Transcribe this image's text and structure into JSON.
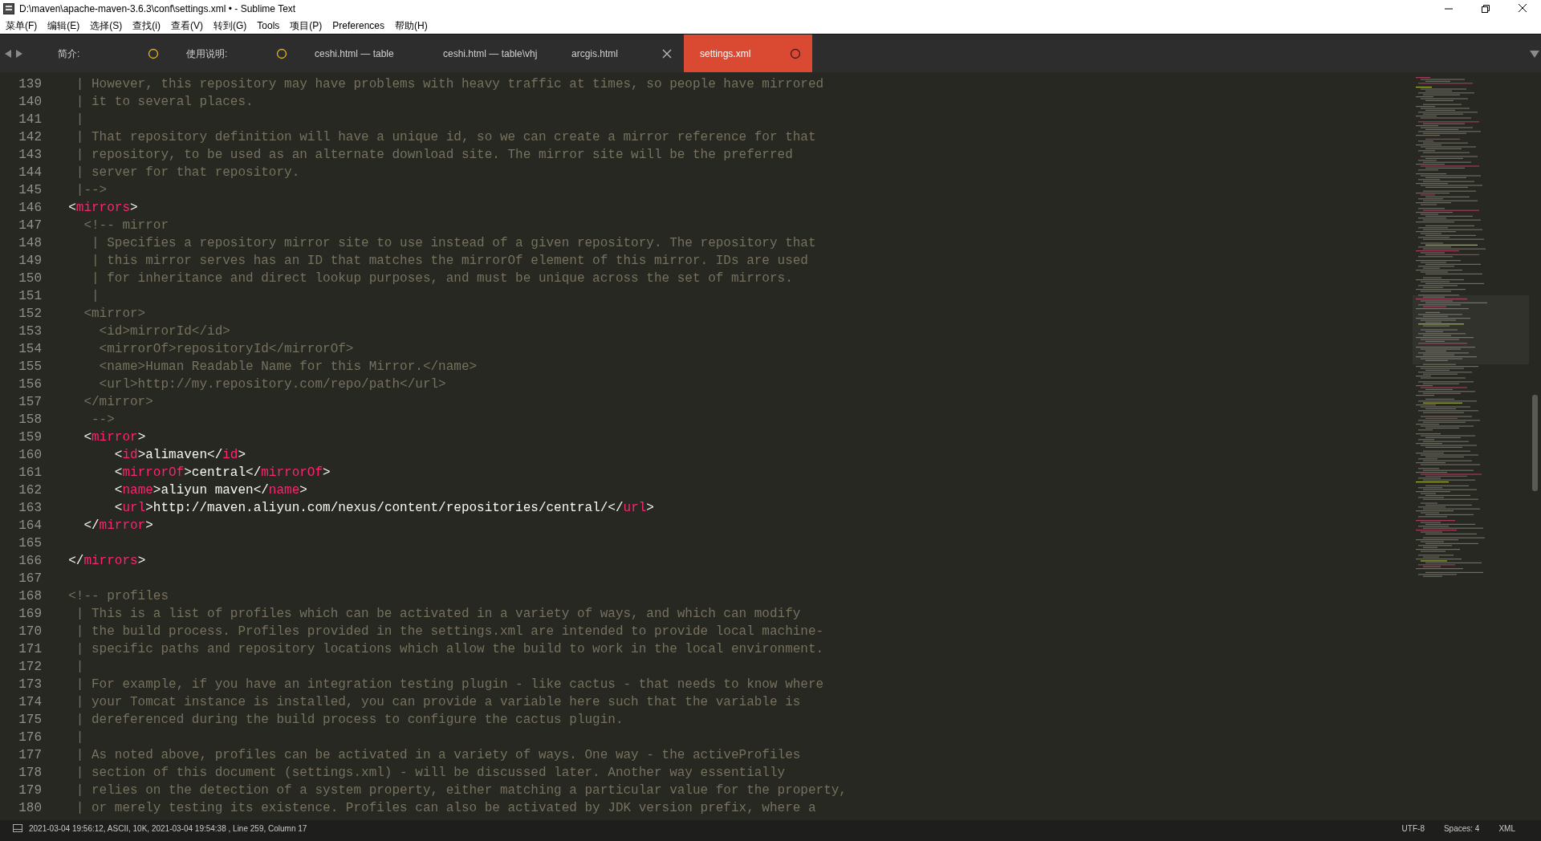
{
  "window": {
    "title": "D:\\maven\\apache-maven-3.6.3\\conf\\settings.xml • - Sublime Text"
  },
  "menu": [
    "菜单(F)",
    "编辑(E)",
    "选择(S)",
    "查找(i)",
    "查看(V)",
    "转到(G)",
    "Tools",
    "项目(P)",
    "Preferences",
    "帮助(H)"
  ],
  "tabs": [
    {
      "label": "简介:",
      "selected": false,
      "unsaved": true,
      "close_shown": false
    },
    {
      "label": "使用说明:",
      "selected": false,
      "unsaved": true,
      "close_shown": false
    },
    {
      "label": "ceshi.html — table",
      "selected": false,
      "unsaved": false,
      "close_shown": false
    },
    {
      "label": "ceshi.html — table\\vhj",
      "selected": false,
      "unsaved": false,
      "close_shown": false
    },
    {
      "label": "arcgis.html",
      "selected": false,
      "unsaved": false,
      "close_shown": true
    },
    {
      "label": "settings.xml",
      "selected": true,
      "unsaved": true,
      "close_shown": false
    }
  ],
  "editor": {
    "lines": [
      {
        "number": "139",
        "tokens": [
          {
            "kind": "comment",
            "text": "   | However, this repository may have problems with heavy traffic at times, so people have mirrored"
          }
        ]
      },
      {
        "number": "140",
        "tokens": [
          {
            "kind": "comment",
            "text": "   | it to several places."
          }
        ]
      },
      {
        "number": "141",
        "tokens": [
          {
            "kind": "comment",
            "text": "   |"
          }
        ]
      },
      {
        "number": "142",
        "tokens": [
          {
            "kind": "comment",
            "text": "   | That repository definition will have a unique id, so we can create a mirror reference for that"
          }
        ]
      },
      {
        "number": "143",
        "tokens": [
          {
            "kind": "comment",
            "text": "   | repository, to be used as an alternate download site. The mirror site will be the preferred"
          }
        ]
      },
      {
        "number": "144",
        "tokens": [
          {
            "kind": "comment",
            "text": "   | server for that repository."
          }
        ]
      },
      {
        "number": "145",
        "tokens": [
          {
            "kind": "comment",
            "text": "   |-->"
          }
        ]
      },
      {
        "number": "146",
        "tokens": [
          {
            "kind": "punct",
            "text": "  <"
          },
          {
            "kind": "tag",
            "text": "mirrors"
          },
          {
            "kind": "punct",
            "text": ">"
          }
        ]
      },
      {
        "number": "147",
        "tokens": [
          {
            "kind": "comment",
            "text": "    <!-- mirror"
          }
        ]
      },
      {
        "number": "148",
        "tokens": [
          {
            "kind": "comment",
            "text": "     | Specifies a repository mirror site to use instead of a given repository. The repository that"
          }
        ]
      },
      {
        "number": "149",
        "tokens": [
          {
            "kind": "comment",
            "text": "     | this mirror serves has an ID that matches the mirrorOf element of this mirror. IDs are used"
          }
        ]
      },
      {
        "number": "150",
        "tokens": [
          {
            "kind": "comment",
            "text": "     | for inheritance and direct lookup purposes, and must be unique across the set of mirrors."
          }
        ]
      },
      {
        "number": "151",
        "tokens": [
          {
            "kind": "comment",
            "text": "     |"
          }
        ]
      },
      {
        "number": "152",
        "tokens": [
          {
            "kind": "comment",
            "text": "    <mirror>"
          }
        ]
      },
      {
        "number": "153",
        "tokens": [
          {
            "kind": "comment",
            "text": "      <id>mirrorId</id>"
          }
        ]
      },
      {
        "number": "154",
        "tokens": [
          {
            "kind": "comment",
            "text": "      <mirrorOf>repositoryId</mirrorOf>"
          }
        ]
      },
      {
        "number": "155",
        "tokens": [
          {
            "kind": "comment",
            "text": "      <name>Human Readable Name for this Mirror.</name>"
          }
        ]
      },
      {
        "number": "156",
        "tokens": [
          {
            "kind": "comment",
            "text": "      <url>http://my.repository.com/repo/path</url>"
          }
        ]
      },
      {
        "number": "157",
        "tokens": [
          {
            "kind": "comment",
            "text": "    </mirror>"
          }
        ]
      },
      {
        "number": "158",
        "tokens": [
          {
            "kind": "comment",
            "text": "     -->"
          }
        ]
      },
      {
        "number": "159",
        "tokens": [
          {
            "kind": "punct",
            "text": "    <"
          },
          {
            "kind": "tag",
            "text": "mirror"
          },
          {
            "kind": "punct",
            "text": ">"
          }
        ]
      },
      {
        "number": "160",
        "tokens": [
          {
            "kind": "punct",
            "text": "        <"
          },
          {
            "kind": "tag",
            "text": "id"
          },
          {
            "kind": "punct",
            "text": ">alimaven</"
          },
          {
            "kind": "tag",
            "text": "id"
          },
          {
            "kind": "punct",
            "text": ">"
          }
        ]
      },
      {
        "number": "161",
        "tokens": [
          {
            "kind": "punct",
            "text": "        <"
          },
          {
            "kind": "tag",
            "text": "mirrorOf"
          },
          {
            "kind": "punct",
            "text": ">central</"
          },
          {
            "kind": "tag",
            "text": "mirrorOf"
          },
          {
            "kind": "punct",
            "text": ">"
          }
        ]
      },
      {
        "number": "162",
        "tokens": [
          {
            "kind": "punct",
            "text": "        <"
          },
          {
            "kind": "tag",
            "text": "name"
          },
          {
            "kind": "punct",
            "text": ">aliyun maven</"
          },
          {
            "kind": "tag",
            "text": "name"
          },
          {
            "kind": "punct",
            "text": ">"
          }
        ]
      },
      {
        "number": "163",
        "tokens": [
          {
            "kind": "punct",
            "text": "        <"
          },
          {
            "kind": "tag",
            "text": "url"
          },
          {
            "kind": "punct",
            "text": ">http://maven.aliyun.com/nexus/content/repositories/central/</"
          },
          {
            "kind": "tag",
            "text": "url"
          },
          {
            "kind": "punct",
            "text": ">"
          }
        ]
      },
      {
        "number": "164",
        "tokens": [
          {
            "kind": "punct",
            "text": "    </"
          },
          {
            "kind": "tag",
            "text": "mirror"
          },
          {
            "kind": "punct",
            "text": ">"
          }
        ]
      },
      {
        "number": "165"
      },
      {
        "number": "166",
        "tokens": [
          {
            "kind": "punct",
            "text": "  </"
          },
          {
            "kind": "tag",
            "text": "mirrors"
          },
          {
            "kind": "punct",
            "text": ">"
          }
        ]
      },
      {
        "number": "167"
      },
      {
        "number": "168",
        "tokens": [
          {
            "kind": "comment",
            "text": "  <!-- profiles"
          }
        ]
      },
      {
        "number": "169",
        "tokens": [
          {
            "kind": "comment",
            "text": "   | This is a list of profiles which can be activated in a variety of ways, and which can modify"
          }
        ]
      },
      {
        "number": "170",
        "tokens": [
          {
            "kind": "comment",
            "text": "   | the build process. Profiles provided in the settings.xml are intended to provide local machine-"
          }
        ]
      },
      {
        "number": "171",
        "tokens": [
          {
            "kind": "comment",
            "text": "   | specific paths and repository locations which allow the build to work in the local environment."
          }
        ]
      },
      {
        "number": "172",
        "tokens": [
          {
            "kind": "comment",
            "text": "   |"
          }
        ]
      },
      {
        "number": "173",
        "tokens": [
          {
            "kind": "comment",
            "text": "   | For example, if you have an integration testing plugin - like cactus - that needs to know where"
          }
        ]
      },
      {
        "number": "174",
        "tokens": [
          {
            "kind": "comment",
            "text": "   | your Tomcat instance is installed, you can provide a variable here such that the variable is"
          }
        ]
      },
      {
        "number": "175",
        "tokens": [
          {
            "kind": "comment",
            "text": "   | dereferenced during the build process to configure the cactus plugin."
          }
        ]
      },
      {
        "number": "176",
        "tokens": [
          {
            "kind": "comment",
            "text": "   |"
          }
        ]
      },
      {
        "number": "177",
        "tokens": [
          {
            "kind": "comment",
            "text": "   | As noted above, profiles can be activated in a variety of ways. One way - the activeProfiles"
          }
        ]
      },
      {
        "number": "178",
        "tokens": [
          {
            "kind": "comment",
            "text": "   | section of this document (settings.xml) - will be discussed later. Another way essentially"
          }
        ]
      },
      {
        "number": "179",
        "tokens": [
          {
            "kind": "comment",
            "text": "   | relies on the detection of a system property, either matching a particular value for the property,"
          }
        ]
      },
      {
        "number": "180",
        "tokens": [
          {
            "kind": "comment",
            "text": "   | or merely testing its existence. Profiles can also be activated by JDK version prefix, where a"
          }
        ]
      }
    ]
  },
  "status_bar": {
    "info": "2021-03-04 19:56:12, ASCII, 10K, 2021-03-04 19:54:38 , Line 259, Column 17",
    "right": [
      "UTF-8",
      "Spaces: 4",
      "XML"
    ]
  }
}
